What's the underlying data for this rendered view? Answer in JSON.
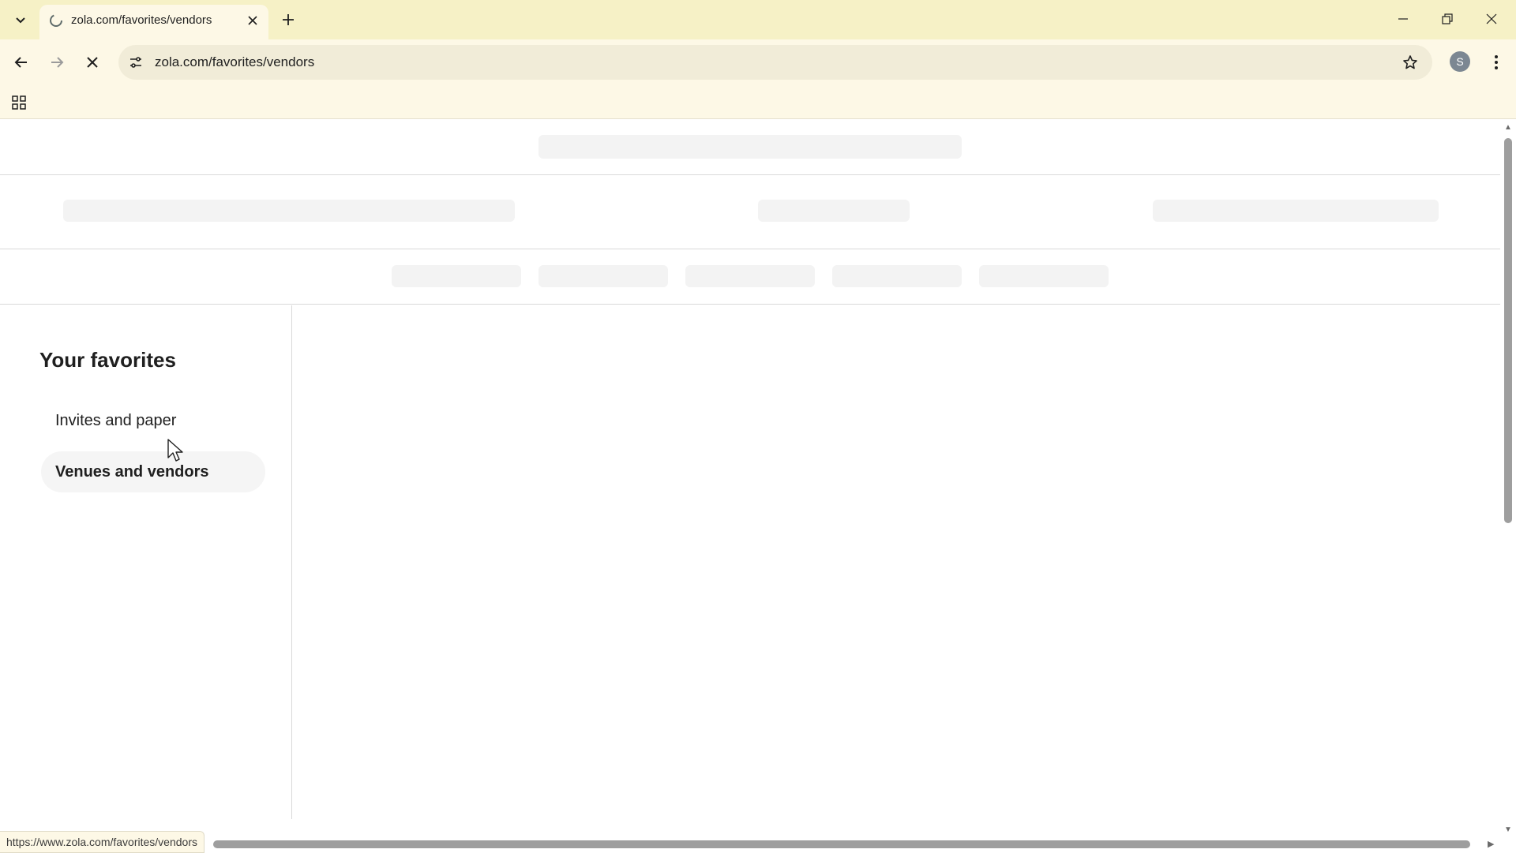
{
  "browser": {
    "tab": {
      "title": "zola.com/favorites/vendors",
      "favicon": "loading-spinner-icon"
    },
    "address_bar": {
      "url": "zola.com/favorites/vendors"
    },
    "profile_initial": "S",
    "status_url": "https://www.zola.com/favorites/vendors",
    "theme_color": "#f6f1c6"
  },
  "sidebar": {
    "heading": "Your favorites",
    "items": [
      {
        "label": "Invites and paper",
        "active": false
      },
      {
        "label": "Venues and vendors",
        "active": true
      }
    ]
  },
  "page_state": "loading"
}
